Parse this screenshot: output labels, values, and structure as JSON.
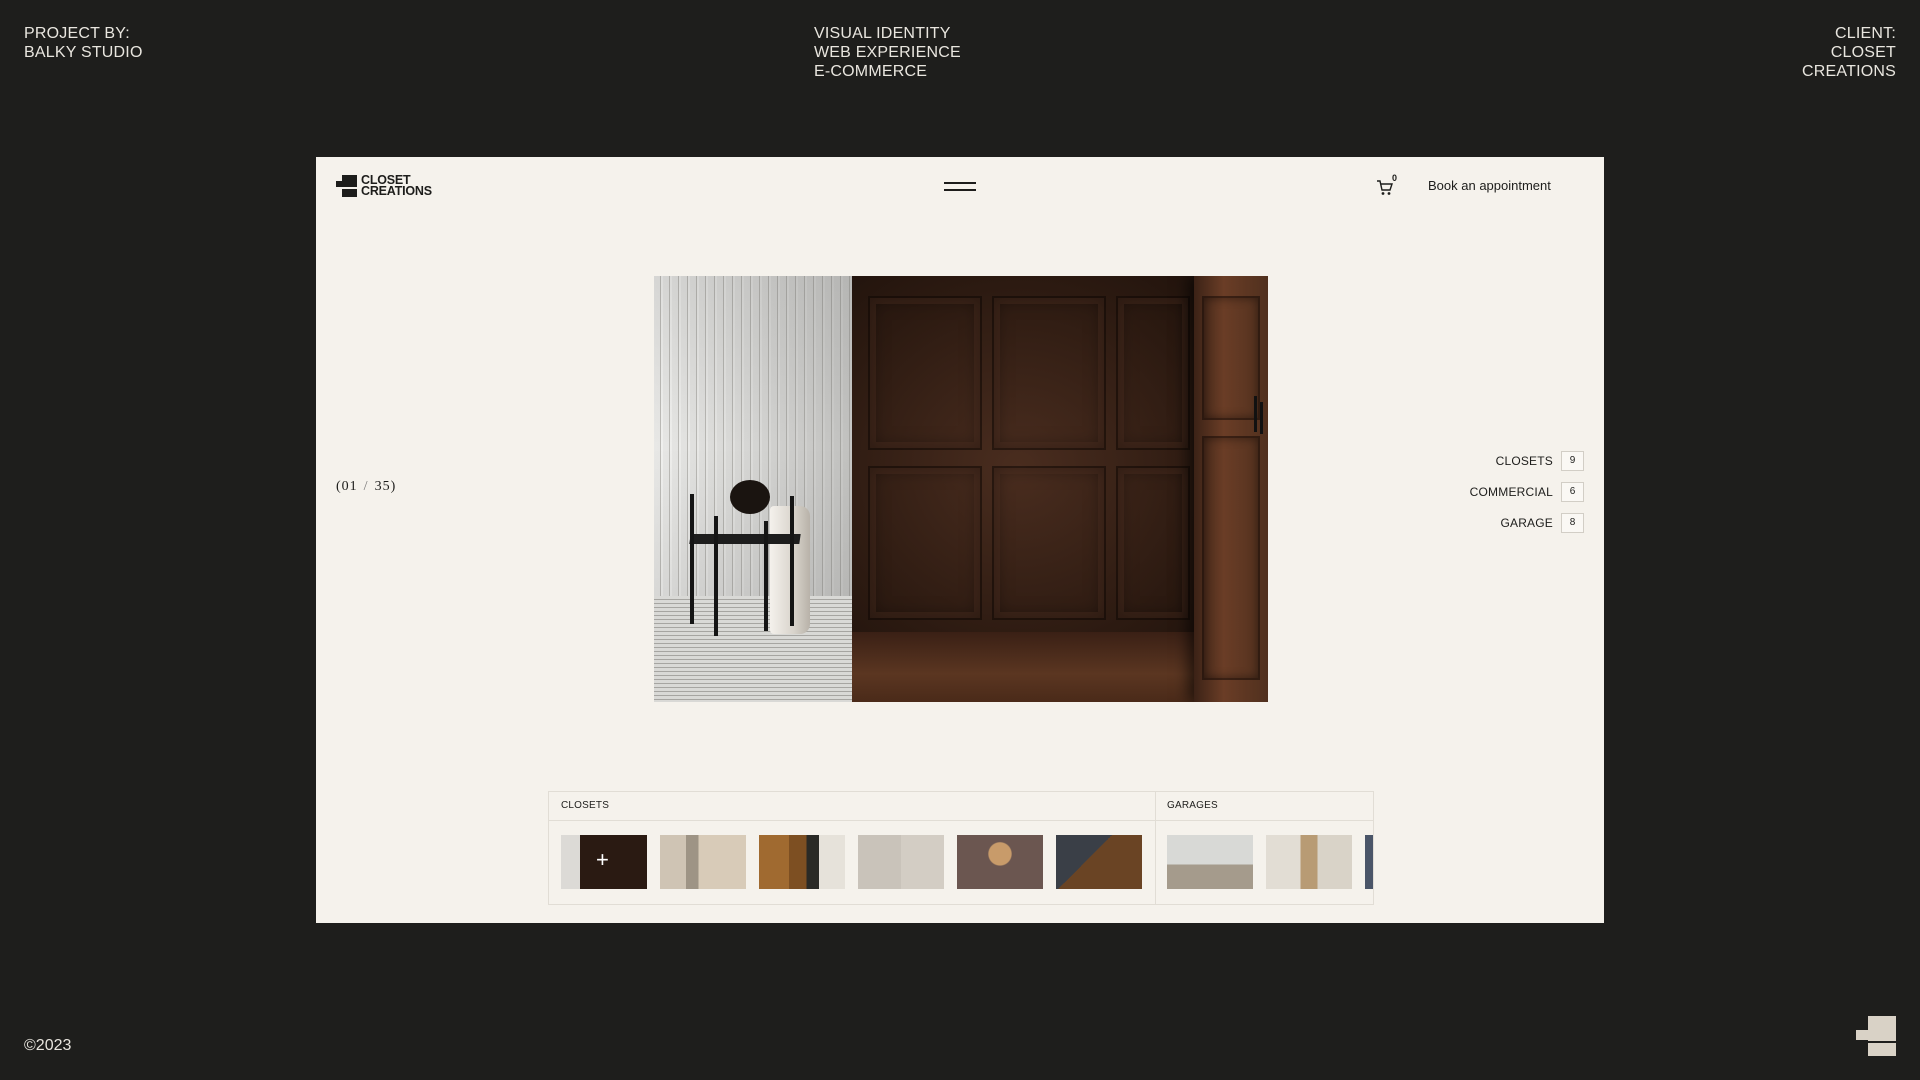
{
  "meta": {
    "left": [
      "PROJECT BY:",
      "BALKY STUDIO"
    ],
    "center": [
      "VISUAL IDENTITY",
      "WEB EXPERIENCE",
      "E-COMMERCE"
    ],
    "right": [
      "CLIENT:",
      "CLOSET",
      "CREATIONS"
    ]
  },
  "site": {
    "logo": [
      "CLOSET",
      "CREATIONS"
    ],
    "cart_count": "0",
    "book_label": "Book an appointment"
  },
  "slider": {
    "current": "01",
    "separator": "/",
    "total": "35"
  },
  "categories": [
    {
      "label": "CLOSETS",
      "count": "9"
    },
    {
      "label": "COMMERCIAL",
      "count": "6"
    },
    {
      "label": "GARAGE",
      "count": "8"
    }
  ],
  "strip": {
    "group1": "CLOSETS",
    "group2": "GARAGES",
    "thumb_plus": "+"
  },
  "footer": {
    "copyright": "©2023"
  },
  "colors": {
    "background": "#1e1e1c",
    "frame": "#f5f2ec",
    "text_dark": "#1d1d1b",
    "text_light": "#e9e6df",
    "logo_mark_light": "#d9d2c6"
  }
}
